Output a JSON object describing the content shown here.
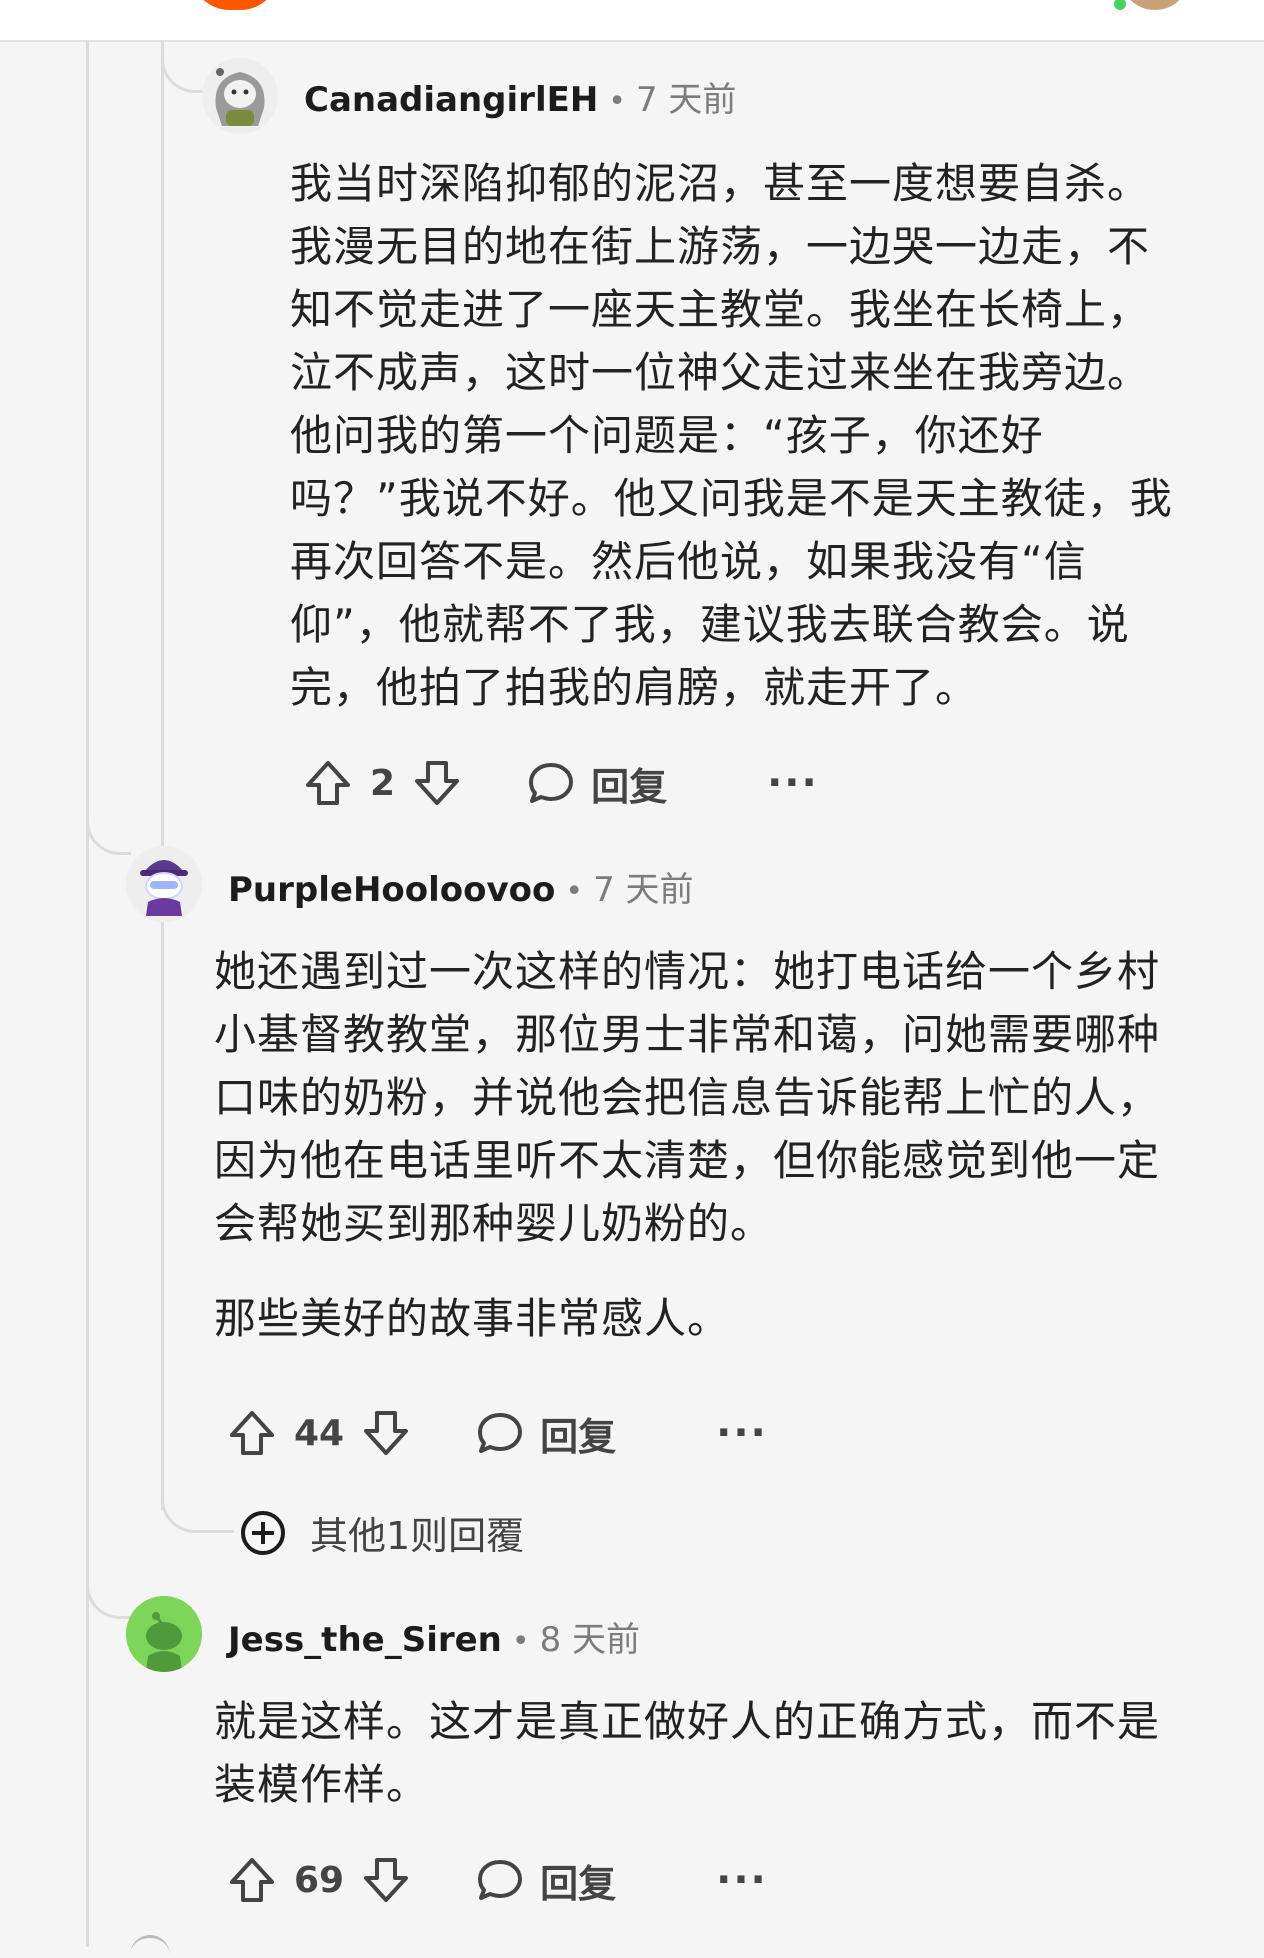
{
  "comments": [
    {
      "username": "CanadiangirlEH",
      "time": "7 天前",
      "paragraphs": [
        "我当时深陷抑郁的泥沼，甚至一度想要自杀。我漫无目的地在街上游荡，一边哭一边走，不知不觉走进了一座天主教堂。我坐在长椅上，泣不成声，这时一位神父走过来坐在我旁边。他问我的第一个问题是：“孩子，你还好吗？”我说不好。他又问我是不是天主教徒，我再次回答不是。然后他说，如果我没有“信仰”，他就帮不了我，建议我去联合教会。说完，他拍了拍我的肩膀，就走开了。"
      ],
      "votes": "2",
      "reply_label": "回复",
      "more_label": "···",
      "avatar_icon": "snoo-avatar-gray-hair"
    },
    {
      "username": "PurpleHooloovoo",
      "time": "7 天前",
      "paragraphs": [
        "她还遇到过一次这样的情况：她打电话给一个乡村小基督教教堂，那位男士非常和蔼，问她需要哪种口味的奶粉，并说他会把信息告诉能帮上忙的人，因为他在电话里听不太清楚，但你能感觉到他一定会帮她买到那种婴儿奶粉的。",
        "那些美好的故事非常感人。"
      ],
      "votes": "44",
      "reply_label": "回复",
      "more_label": "···",
      "avatar_icon": "snoo-avatar-purple-hat"
    },
    {
      "username": "Jess_the_Siren",
      "time": "8 天前",
      "paragraphs": [
        "就是这样。这才是真正做好人的正确方式，而不是装模作样。"
      ],
      "votes": "69",
      "reply_label": "回复",
      "more_label": "···",
      "avatar_icon": "snoo-avatar-green"
    }
  ],
  "more_replies_label": "其他1则回覆",
  "dot": "•",
  "colors": {
    "accent": "#ff5700",
    "thread_line": "#dcdcdc",
    "meta_gray": "#7c7c7c",
    "avatar_green": "#6cc04a"
  }
}
